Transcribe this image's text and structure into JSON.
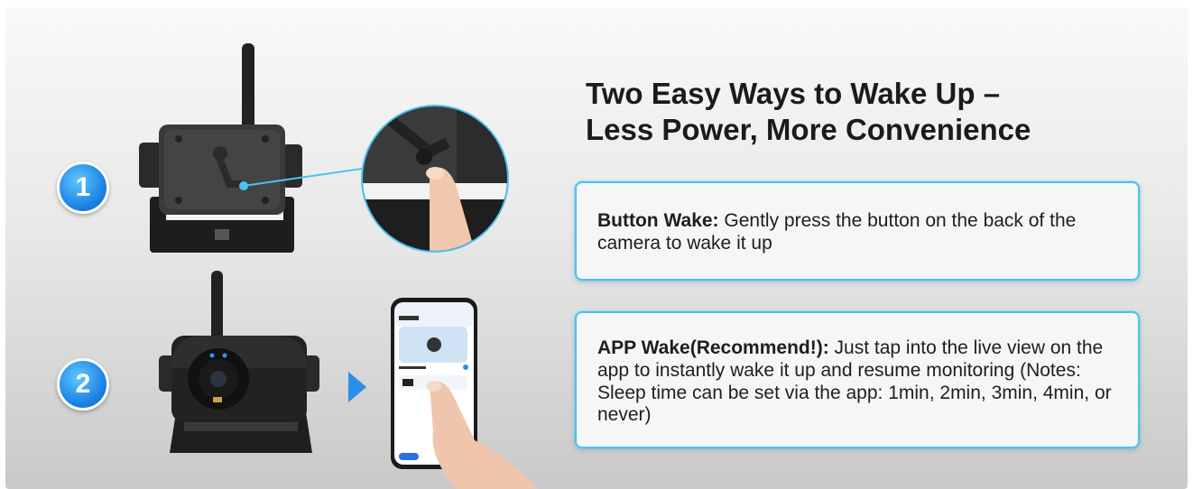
{
  "headline": {
    "line1": "Two Easy Ways to Wake Up –",
    "line2": "Less Power, More Convenience"
  },
  "steps": [
    "1",
    "2"
  ],
  "cards": [
    {
      "title": "Button Wake:",
      "text": " Gently press the button on the back of the camera to wake it up"
    },
    {
      "title": "APP Wake(Recommend!):",
      "text": " Just tap into the live view on the app to instantly wake it up and resume monitoring (Notes: Sleep time can be set via the app: 1min, 2min, 3min, 4min, or never)"
    }
  ],
  "colors": {
    "accent_border": "#48c4ee",
    "step_badge": "#1f86e6",
    "arrow": "#2a8fe6"
  }
}
